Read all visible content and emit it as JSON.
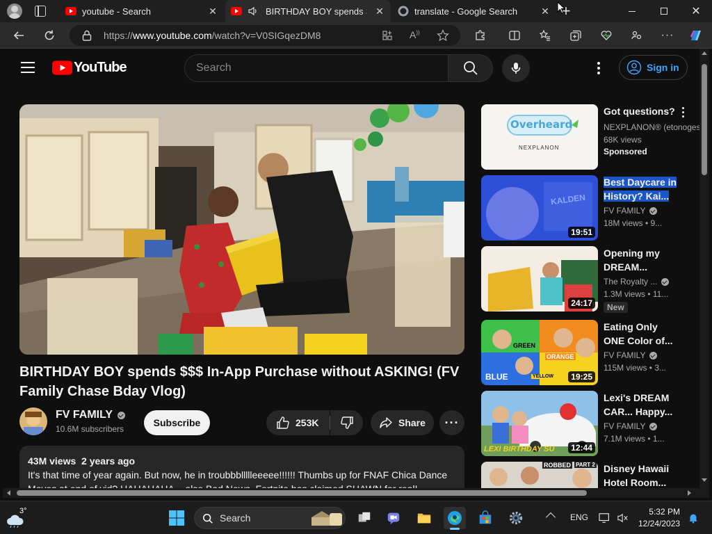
{
  "browser": {
    "tabs": [
      {
        "title": "youtube - Search",
        "active": false
      },
      {
        "title": "BIRTHDAY BOY spends $$$",
        "active": true
      },
      {
        "title": "translate - Google Search",
        "active": false
      }
    ],
    "url_prefix": "https://",
    "url_host": "www.youtube.com",
    "url_path": "/watch?v=V0SIGqezDM8"
  },
  "youtube": {
    "logo_text": "YouTube",
    "search_placeholder": "Search",
    "sign_in_label": "Sign in"
  },
  "video": {
    "title": "BIRTHDAY BOY spends $$$ In-App Purchase without ASKING! (FV Family Chase Bday Vlog)",
    "channel": "FV FAMILY",
    "subscribers": "10.6M subscribers",
    "subscribe_label": "Subscribe",
    "likes": "253K",
    "share_label": "Share",
    "views": "43M views",
    "age": "2 years ago",
    "description": "It's that time of year again.  But now, he in troubbbllllleeeee!!!!!!  Thumbs up for FNAF Chica Dance Moves at end of vid? HAHAHAHA... also Bad News, Fortnite has claimed SHAWN for real!"
  },
  "related": [
    {
      "title": "Got questions?",
      "channel": "NEXPLANON® (etonogestrel",
      "meta": "68K views",
      "extra": "Sponsored",
      "duration": "",
      "thumb_text": "Overheard",
      "thumb_sub": "NEXPLANON"
    },
    {
      "title": "Best Daycare in History? Kai...",
      "channel": "FV FAMILY",
      "meta": "18M views  • 9...",
      "duration": "19:51",
      "thumb_text": "KALDEN"
    },
    {
      "title": "Opening my DREAM...",
      "channel": "The Royalty ...",
      "meta": "1.3M views  • 11...",
      "badge": "New",
      "duration": "24:17"
    },
    {
      "title": "Eating Only ONE Color of...",
      "channel": "FV FAMILY",
      "meta": "115M views  • 3...",
      "duration": "19:25",
      "thumb_labels": [
        "GREEN",
        "ORANGE",
        "BLUE",
        "YELLOW"
      ]
    },
    {
      "title": "Lexi's DREAM CAR... Happy...",
      "channel": "FV FAMILY",
      "meta": "7.1M views  • 1...",
      "duration": "12:44",
      "thumb_text": "LEXI BIRTHDAY SU"
    },
    {
      "title": "Disney Hawaii Hotel Room...",
      "channel": "",
      "meta": "",
      "duration": "",
      "thumb_text": "ROBBED",
      "thumb_sub": "PART 2"
    }
  ],
  "taskbar": {
    "weather_temp": "3°",
    "search_label": "Search",
    "language": "ENG",
    "time": "5:32 PM",
    "date": "12/24/2023"
  },
  "colors": {
    "youtube_red": "#ff0000",
    "link_blue": "#3ea6ff",
    "selection": "#1a56c8",
    "page_bg": "#0f0f0f"
  }
}
